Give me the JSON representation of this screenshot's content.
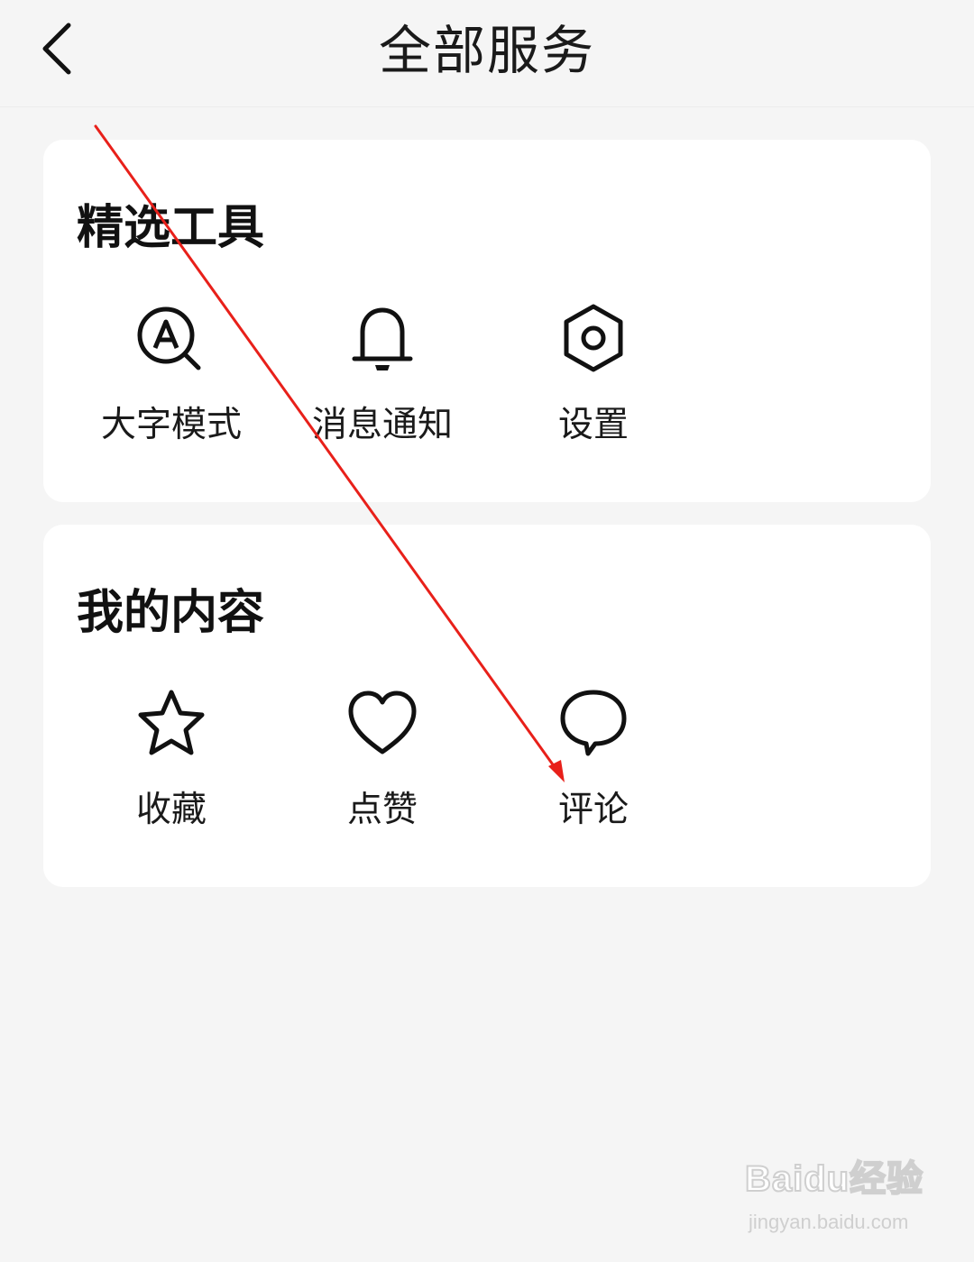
{
  "header": {
    "title": "全部服务",
    "back_icon": "chevron-left-icon"
  },
  "sections": [
    {
      "title": "精选工具",
      "items": [
        {
          "label": "大字模式",
          "icon": "magnifier-letter-a-icon"
        },
        {
          "label": "消息通知",
          "icon": "bell-icon"
        },
        {
          "label": "设置",
          "icon": "hexagon-gear-icon"
        }
      ]
    },
    {
      "title": "我的内容",
      "items": [
        {
          "label": "收藏",
          "icon": "star-icon"
        },
        {
          "label": "点赞",
          "icon": "heart-icon"
        },
        {
          "label": "评论",
          "icon": "speech-bubble-icon"
        }
      ]
    }
  ],
  "annotation": {
    "arrow_color": "#e8201a",
    "arrow_target": "评论"
  },
  "watermark": {
    "logo_text": "Baidu经验",
    "url": "jingyan.baidu.com"
  },
  "colors": {
    "background": "#f5f5f5",
    "card": "#ffffff",
    "text": "#1a1a1a",
    "icon_stroke": "#111111"
  }
}
